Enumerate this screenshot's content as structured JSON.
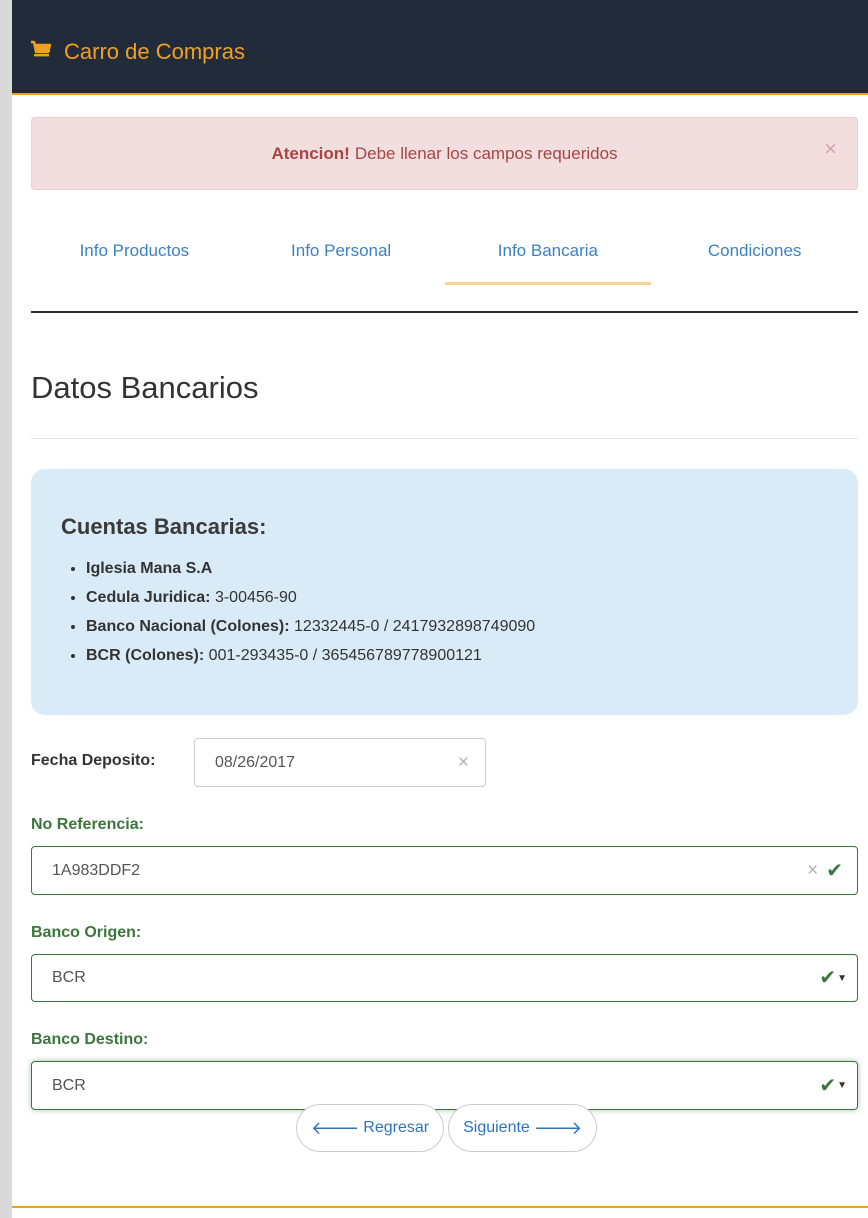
{
  "navbar": {
    "brand_title": "Carro de Compras",
    "brand_color": "#f0a020",
    "icon": "shopping-cart-icon"
  },
  "alert": {
    "strong": "Atencion!",
    "message": "Debe llenar los campos requeridos",
    "close": "×"
  },
  "tabs": [
    {
      "label": "Info Productos",
      "active": false
    },
    {
      "label": "Info Personal",
      "active": false
    },
    {
      "label": "Info Bancaria",
      "active": true
    },
    {
      "label": "Condiciones",
      "active": false
    }
  ],
  "section": {
    "title": "Datos Bancarios"
  },
  "accounts": {
    "title": "Cuentas Bancarias:",
    "items": [
      {
        "label": "Iglesia Mana S.A",
        "value": ""
      },
      {
        "label": "Cedula Juridica:",
        "value": "3-00456-90"
      },
      {
        "label": "Banco Nacional (Colones):",
        "value": "12332445-0 / 2417932898749090"
      },
      {
        "label": "BCR (Colones):",
        "value": "001-293435-0 / 365456789778900121"
      }
    ]
  },
  "form": {
    "fecha": {
      "label": "Fecha Deposito:",
      "value": "08/26/2017"
    },
    "referencia": {
      "label": "No Referencia:",
      "value": "1A983DDF2"
    },
    "banco_origen": {
      "label": "Banco Origen:",
      "value": "BCR"
    },
    "banco_destino": {
      "label": "Banco Destino:",
      "value": "BCR"
    },
    "success_color": "#3c763d"
  },
  "buttons": {
    "back": "Regresar",
    "next": "Siguiente"
  }
}
